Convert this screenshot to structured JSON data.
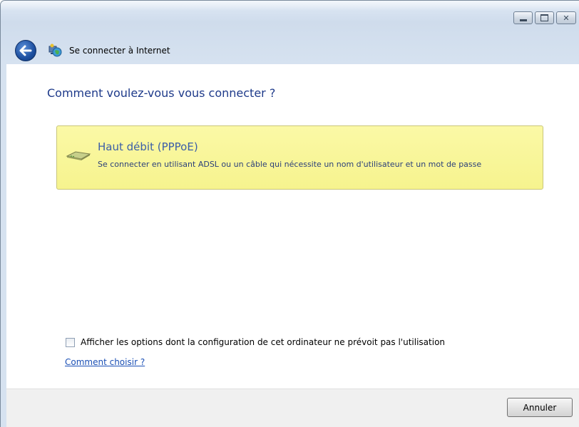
{
  "window": {
    "title": "Se connecter à Internet",
    "caption_buttons": [
      "minimize",
      "maximize",
      "close"
    ]
  },
  "main": {
    "question": "Comment voulez-vous vous connecter ?",
    "options": [
      {
        "title": "Haut débit (PPPoE)",
        "description": "Se connecter en utilisant ADSL ou un câble qui nécessite un nom d'utilisateur et un mot de passe",
        "icon": "broadband-modem-icon",
        "highlight_color": "#f8f69c"
      }
    ],
    "show_all_checkbox": {
      "label": "Afficher les options dont la configuration de cet ordinateur ne prévoit pas l'utilisation",
      "checked": false
    },
    "help_link": "Comment choisir ?"
  },
  "footer": {
    "cancel_label": "Annuler"
  },
  "colors": {
    "heading": "#1e3a8a",
    "link": "#1a4fb5",
    "option_bg": "#f8f69c"
  }
}
